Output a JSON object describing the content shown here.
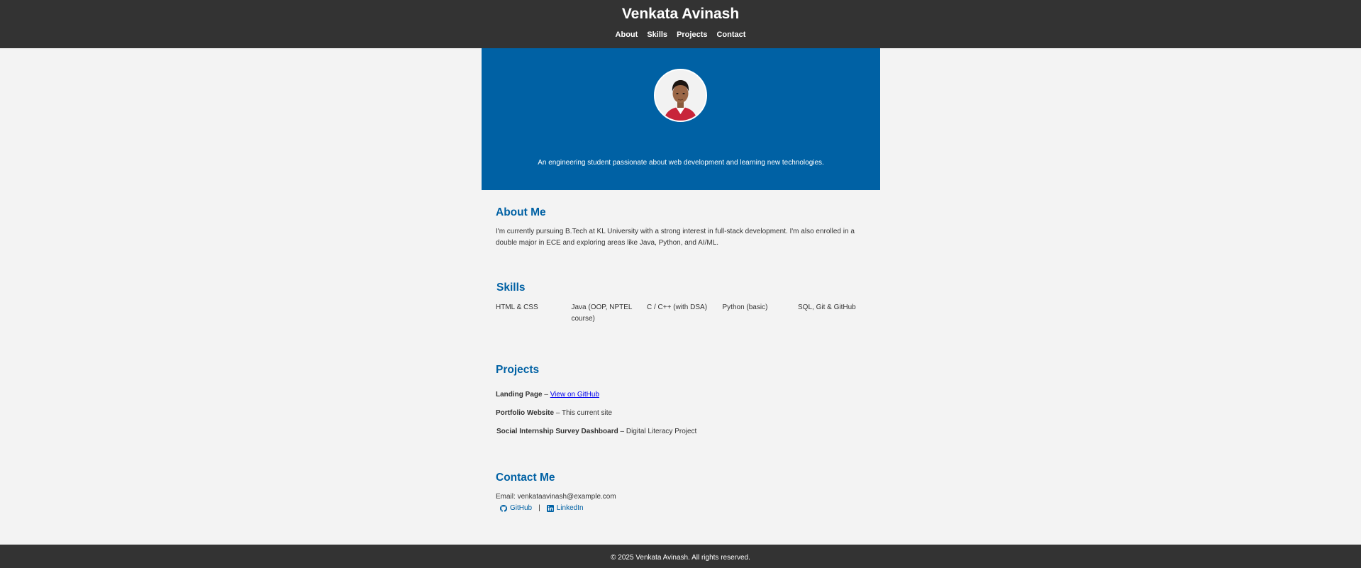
{
  "header": {
    "title": "Venkata Avinash",
    "nav": [
      "About",
      "Skills",
      "Projects",
      "Contact"
    ]
  },
  "hero": {
    "tagline": "An engineering student passionate about web development and learning new technologies."
  },
  "about": {
    "heading": "About Me",
    "text": "I'm currently pursuing B.Tech at KL University with a strong interest in full-stack development. I'm also enrolled in a double major in ECE and exploring areas like Java, Python, and AI/ML."
  },
  "skills": {
    "heading": "Skills",
    "items": [
      "HTML & CSS",
      "Java (OOP, NPTEL course)",
      "C / C++ (with DSA)",
      "Python (basic)",
      "SQL, Git & GitHub"
    ]
  },
  "projects": {
    "heading": "Projects",
    "items": [
      {
        "name": "Landing Page",
        "sep": " – ",
        "link": "View on GitHub"
      },
      {
        "name": "Portfolio Website",
        "sep": " – ",
        "desc": "This current site"
      },
      {
        "name": "Social Internship Survey Dashboard",
        "sep": " – ",
        "desc": "Digital Literacy Project"
      }
    ]
  },
  "contact": {
    "heading": "Contact Me",
    "email_label": "Email: ",
    "email": "venkataavinash@example.com",
    "github": "GitHub",
    "divider": "|",
    "linkedin": "LinkedIn"
  },
  "footer": {
    "text": "© 2025 Venkata Avinash. All rights reserved."
  },
  "colors": {
    "header_bg": "#333333",
    "hero_bg": "#0061a4",
    "accent": "#0061a4",
    "page_bg": "#f3f3f3"
  }
}
